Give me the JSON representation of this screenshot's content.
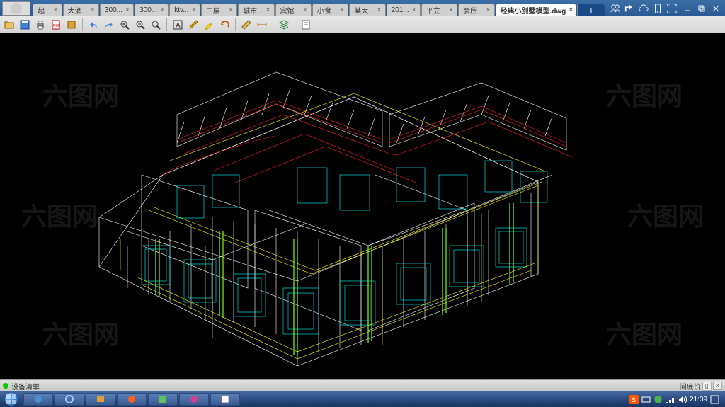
{
  "titlebar": {
    "tabs": [
      {
        "label": "起...",
        "close": "×"
      },
      {
        "label": "大酒...",
        "close": "×"
      },
      {
        "label": "300...",
        "close": "×"
      },
      {
        "label": "300...",
        "close": "×"
      },
      {
        "label": "ktv...",
        "close": "×"
      },
      {
        "label": "二层...",
        "close": "×"
      },
      {
        "label": "城市...",
        "close": "×"
      },
      {
        "label": "宾馆...",
        "close": "×"
      },
      {
        "label": "小食...",
        "close": "×"
      },
      {
        "label": "某大...",
        "close": "×"
      },
      {
        "label": "201...",
        "close": "×"
      },
      {
        "label": "平立...",
        "close": "×"
      },
      {
        "label": "会所...",
        "close": "×"
      }
    ],
    "active_tab": {
      "label": "经典小别墅模型.dwg",
      "close": "×"
    },
    "new_tab": "+"
  },
  "statusbar": {
    "left": "设备清单",
    "right_label": "问底价",
    "btn1": "▯",
    "btn2": "×"
  },
  "taskbar": {
    "clock": "21:39"
  },
  "watermark_text": "六图网",
  "colors": {
    "wire_white": "#ffffff",
    "wire_red": "#ff2020",
    "wire_cyan": "#00ffff",
    "wire_yellow": "#ffff00",
    "wire_green": "#80ff00"
  }
}
